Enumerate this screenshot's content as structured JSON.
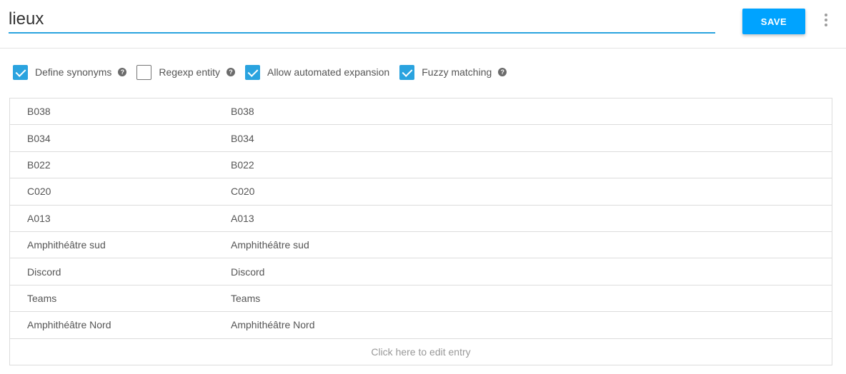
{
  "entity": {
    "name": "lieux"
  },
  "toolbar": {
    "save_label": "SAVE",
    "more_icon": "more-vert-icon"
  },
  "options": [
    {
      "label": "Define synonyms",
      "checked": true,
      "has_help": true
    },
    {
      "label": "Regexp entity",
      "checked": false,
      "has_help": true
    },
    {
      "label": "Allow automated expansion",
      "checked": true,
      "has_help": false
    },
    {
      "label": "Fuzzy matching",
      "checked": true,
      "has_help": true
    }
  ],
  "help_glyph": "?",
  "entries": [
    {
      "value": "B038",
      "synonym": "B038"
    },
    {
      "value": "B034",
      "synonym": "B034"
    },
    {
      "value": "B022",
      "synonym": "B022"
    },
    {
      "value": "C020",
      "synonym": "C020"
    },
    {
      "value": "A013",
      "synonym": "A013"
    },
    {
      "value": "Amphithéâtre sud",
      "synonym": "Amphithéâtre sud"
    },
    {
      "value": "Discord",
      "synonym": "Discord"
    },
    {
      "value": "Teams",
      "synonym": "Teams"
    },
    {
      "value": "Amphithéâtre Nord",
      "synonym": "Amphithéâtre Nord"
    }
  ],
  "edit_entry_label": "Click here to edit entry",
  "colors": {
    "accent": "#2aa3df",
    "save_button": "#00a3ff"
  }
}
